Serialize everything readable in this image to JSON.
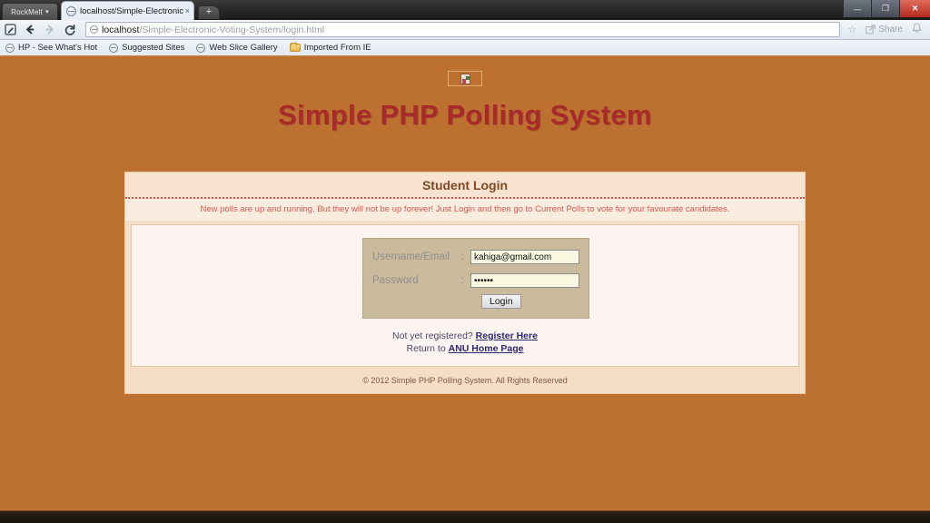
{
  "browser": {
    "rockmelt_tab": "RockMelt",
    "rockmelt_caret": "▾",
    "active_tab_title": "localhost/Simple-Electronic",
    "tab_close": "×",
    "new_tab": "+",
    "window_minimize": "—",
    "window_maximize": "❐",
    "window_close": "✕",
    "back_arrow": "←",
    "forward_arrow": "→",
    "reload": "↻",
    "url_host": "localhost",
    "url_path": "/Simple-Electronic-Voting-System/login.html",
    "star": "☆",
    "share_label": "Share",
    "bell": "⚑",
    "bookmarks": [
      {
        "label": "HP - See What's Hot",
        "icon": "globe-icon"
      },
      {
        "label": "Suggested Sites",
        "icon": "globe-icon"
      },
      {
        "label": "Web Slice Gallery",
        "icon": "globe-icon"
      },
      {
        "label": "Imported From IE",
        "icon": "folder-icon"
      }
    ]
  },
  "page": {
    "site_title": "Simple PHP Polling System",
    "panel_heading": "Student Login",
    "notice": "New polls are up and running. But they will not be up forever! Just Login and then go to Current Polls to vote for your favourate candidates.",
    "form": {
      "username_label": "Username/Email",
      "username_colon": ":",
      "username_value": "kahiga@gmail.com",
      "username_placeholder": "",
      "password_label": "Password",
      "password_colon": ":",
      "password_value": "••••••",
      "password_placeholder": "",
      "login_button": "Login"
    },
    "links": {
      "register_prefix": "Not yet registered?",
      "register_link": "Register Here",
      "return_prefix": "Return to",
      "return_link": "ANU Home Page"
    },
    "copyright": "© 2012 Simple PHP Polling System. All Rights Reserved"
  },
  "colors": {
    "page_background": "#bd7130",
    "title_red": "#a82a2a",
    "panel_cream": "#f6ddc6",
    "notice_red": "#e0564d",
    "form_box_tan": "#c9bb9b",
    "input_yellow": "#f8f8e0",
    "link_blue": "#2a2a6e"
  }
}
